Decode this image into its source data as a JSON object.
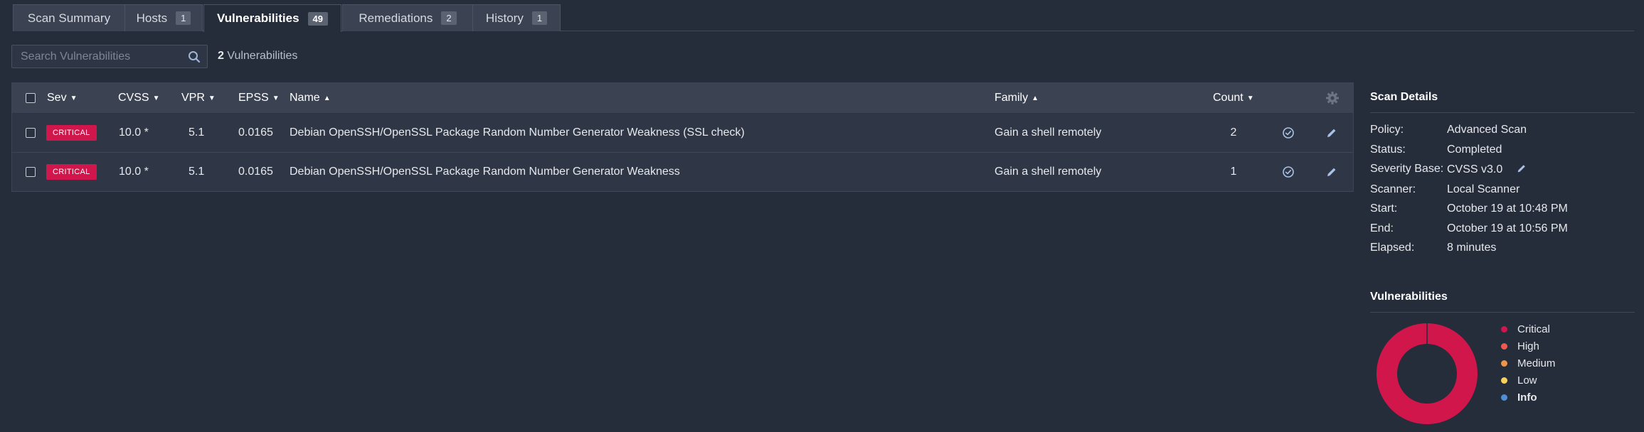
{
  "tabs": [
    {
      "label": "Scan Summary",
      "badge": ""
    },
    {
      "label": "Hosts",
      "badge": "1"
    },
    {
      "label": "Vulnerabilities",
      "badge": "49"
    },
    {
      "label": "Remediations",
      "badge": "2"
    },
    {
      "label": "History",
      "badge": "1"
    }
  ],
  "active_tab": "Vulnerabilities",
  "search": {
    "placeholder": "Search Vulnerabilities",
    "value": ""
  },
  "result_count": {
    "number": "2",
    "label": "Vulnerabilities"
  },
  "table": {
    "columns": {
      "sev": "Sev",
      "cvss": "CVSS",
      "vpr": "VPR",
      "epss": "EPSS",
      "name": "Name",
      "family": "Family",
      "count": "Count"
    },
    "sort_indicators": {
      "down": "▼",
      "up": "▲"
    },
    "rows": [
      {
        "severity": "CRITICAL",
        "cvss": "10.0 *",
        "vpr": "5.1",
        "epss": "0.0165",
        "name": "Debian OpenSSH/OpenSSL Package Random Number Generator Weakness (SSL check)",
        "family": "Gain a shell remotely",
        "count": "2"
      },
      {
        "severity": "CRITICAL",
        "cvss": "10.0 *",
        "vpr": "5.1",
        "epss": "0.0165",
        "name": "Debian OpenSSH/OpenSSL Package Random Number Generator Weakness",
        "family": "Gain a shell remotely",
        "count": "1"
      }
    ]
  },
  "scan_details": {
    "title": "Scan Details",
    "rows": [
      {
        "label": "Policy:",
        "value": "Advanced Scan"
      },
      {
        "label": "Status:",
        "value": "Completed"
      },
      {
        "label": "Severity Base:",
        "value": "CVSS v3.0"
      },
      {
        "label": "Scanner:",
        "value": "Local Scanner"
      },
      {
        "label": "Start:",
        "value": "October 19 at 10:48 PM"
      },
      {
        "label": "End:",
        "value": "October 19 at 10:56 PM"
      },
      {
        "label": "Elapsed:",
        "value": "8 minutes"
      }
    ]
  },
  "vuln_chart": {
    "title": "Vulnerabilities",
    "legend": [
      {
        "label": "Critical",
        "color": "#d1164c"
      },
      {
        "label": "High",
        "color": "#ee5a4f"
      },
      {
        "label": "Medium",
        "color": "#f0944a"
      },
      {
        "label": "Low",
        "color": "#f7d25a"
      },
      {
        "label": "Info",
        "color": "#4f8fd6"
      }
    ]
  },
  "chart_data": {
    "type": "pie",
    "title": "Vulnerabilities",
    "categories": [
      "Critical",
      "High",
      "Medium",
      "Low",
      "Info"
    ],
    "values": [
      2,
      0,
      0,
      0,
      0
    ],
    "colors": [
      "#d1164c",
      "#ee5a4f",
      "#f0944a",
      "#f7d25a",
      "#4f8fd6"
    ],
    "legend_position": "right"
  },
  "icons": {
    "search": "search-icon",
    "settings": "gear-icon",
    "resolve": "check-circle-icon",
    "edit": "pencil-icon"
  },
  "colors": {
    "background": "#252c3a",
    "critical": "#d1164c",
    "tab_bg": "#3b4353"
  }
}
